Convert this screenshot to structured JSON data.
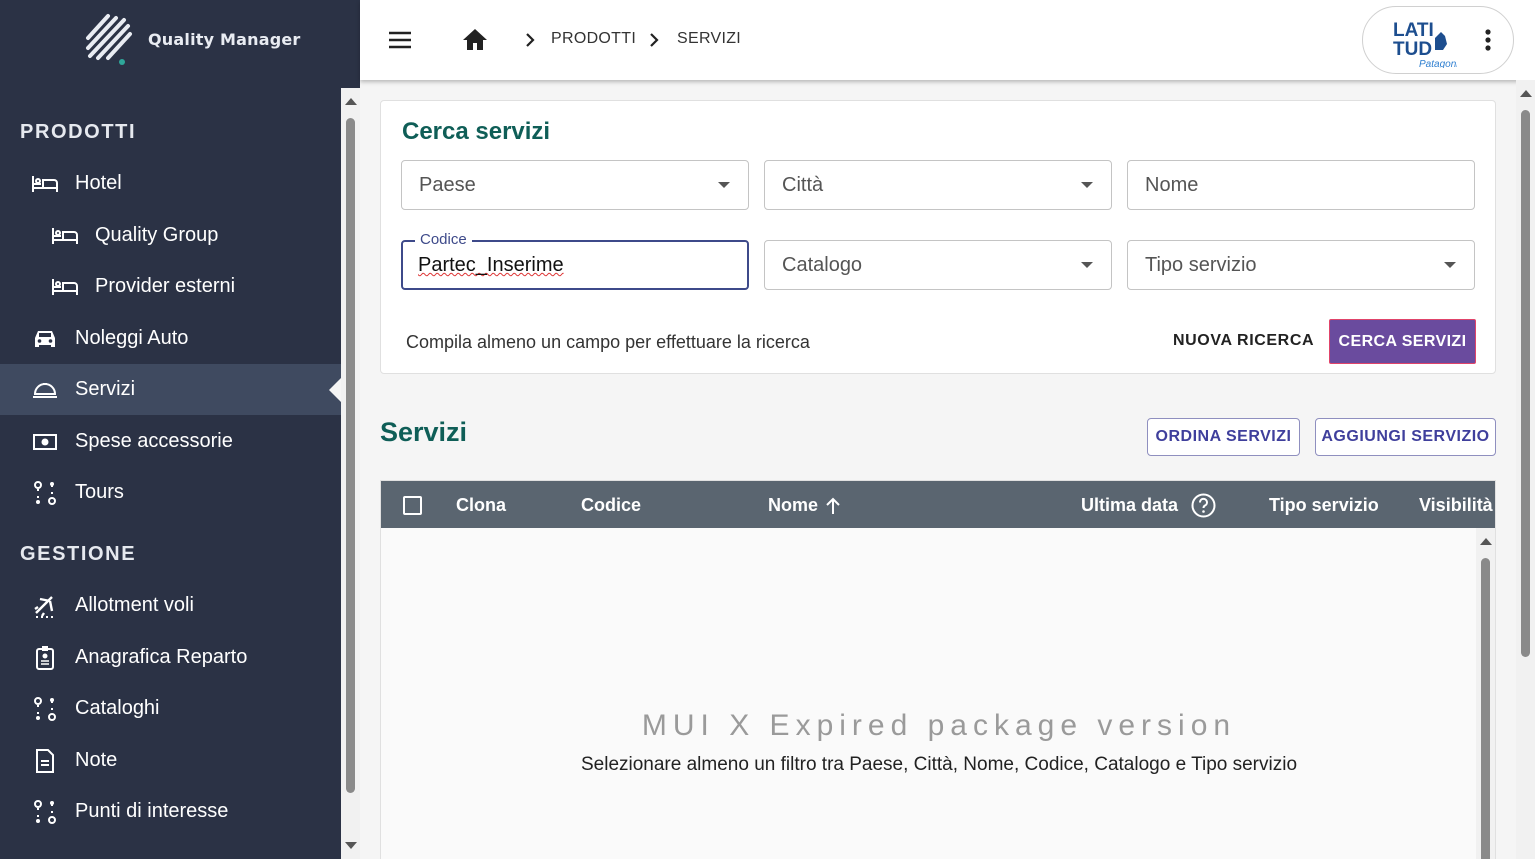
{
  "app": {
    "logo_text": "Quality Manager"
  },
  "sidebar": {
    "sections": [
      {
        "title": "PRODOTTI"
      },
      {
        "title": "GESTIONE"
      }
    ],
    "items": [
      {
        "label": "Hotel",
        "icon": "bed-icon"
      },
      {
        "label": "Quality Group",
        "icon": "bed-icon"
      },
      {
        "label": "Provider esterni",
        "icon": "bed-icon"
      },
      {
        "label": "Noleggi Auto",
        "icon": "car-icon"
      },
      {
        "label": "Servizi",
        "icon": "room-service-icon",
        "active": true
      },
      {
        "label": "Spese accessorie",
        "icon": "money-icon"
      },
      {
        "label": "Tours",
        "icon": "route-icon"
      },
      {
        "label": "Allotment voli",
        "icon": "flight-icon"
      },
      {
        "label": "Anagrafica Reparto",
        "icon": "badge-icon"
      },
      {
        "label": "Cataloghi",
        "icon": "route-icon"
      },
      {
        "label": "Note",
        "icon": "note-icon"
      },
      {
        "label": "Punti di interesse",
        "icon": "route-icon"
      }
    ]
  },
  "topbar": {
    "breadcrumb": [
      "PRODOTTI",
      "SERVIZI"
    ],
    "brand": {
      "line1": "LATI",
      "line2": "TUD",
      "line3": "Patagonia"
    }
  },
  "search": {
    "title": "Cerca servizi",
    "fields": {
      "paese": "Paese",
      "citta": "Città",
      "nome": "Nome",
      "codice_label": "Codice",
      "codice_value": "Partec_Inserime",
      "catalogo": "Catalogo",
      "tipo_servizio": "Tipo servizio"
    },
    "hint": "Compila almeno un campo per effettuare la ricerca",
    "reset_label": "NUOVA RICERCA",
    "submit_label": "CERCA SERVIZI"
  },
  "services": {
    "title": "Servizi",
    "sort_label": "ORDINA SERVIZI",
    "add_label": "AGGIUNGI SERVIZIO",
    "columns": [
      "Clona",
      "Codice",
      "Nome",
      "Ultima data",
      "Tipo servizio",
      "Visibilità"
    ],
    "watermark": "MUI X Expired package version",
    "empty_message": "Selezionare almeno un filtro tra Paese, Città, Nome, Codice, Catalogo e Tipo servizio"
  },
  "colors": {
    "sidebar": "#2b3245",
    "accent": "#0f5e57",
    "primary": "#6a4b9e",
    "grid_header": "#5a6570"
  }
}
